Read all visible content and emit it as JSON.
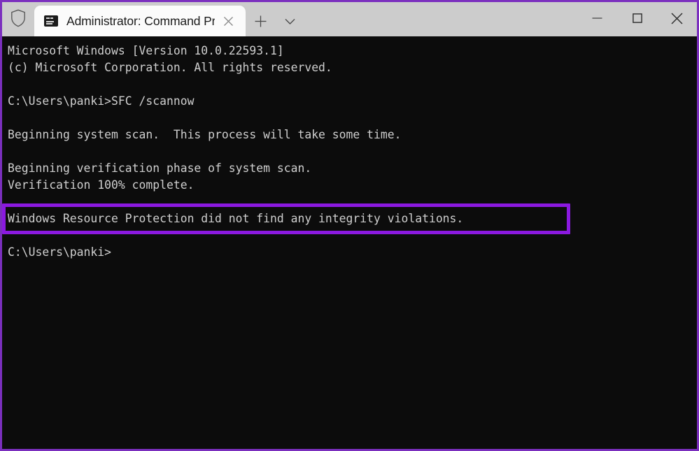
{
  "window": {
    "border_color": "#7b2fbe",
    "titlebar_bg": "#cccccc",
    "terminal_bg": "#0c0c0c",
    "terminal_fg": "#cfcfcf",
    "highlight_color": "#8b19e0"
  },
  "titlebar": {
    "shield_icon": "shield-icon",
    "tab": {
      "icon": "console-icon",
      "title": "Administrator: Command Promp",
      "close_label": "✕"
    },
    "new_tab_label": "+",
    "dropdown_label": "⌄",
    "controls": {
      "minimize": "—",
      "maximize": "☐",
      "close": "✕"
    }
  },
  "terminal": {
    "lines": [
      {
        "id": "version",
        "text": "Microsoft Windows [Version 10.0.22593.1]",
        "blank": false,
        "highlight": false
      },
      {
        "id": "copyright",
        "text": "(c) Microsoft Corporation. All rights reserved.",
        "blank": false,
        "highlight": false
      },
      {
        "id": "blank-1",
        "text": " ",
        "blank": true,
        "highlight": false
      },
      {
        "id": "command-prompt",
        "text": "C:\\Users\\panki>SFC /scannow",
        "blank": false,
        "highlight": false
      },
      {
        "id": "blank-2",
        "text": " ",
        "blank": true,
        "highlight": false
      },
      {
        "id": "scan-begin",
        "text": "Beginning system scan.  This process will take some time.",
        "blank": false,
        "highlight": false
      },
      {
        "id": "blank-3",
        "text": " ",
        "blank": true,
        "highlight": false
      },
      {
        "id": "verify-begin",
        "text": "Beginning verification phase of system scan.",
        "blank": false,
        "highlight": false
      },
      {
        "id": "verify-complete",
        "text": "Verification 100% complete.",
        "blank": false,
        "highlight": false
      },
      {
        "id": "blank-4",
        "text": " ",
        "blank": true,
        "highlight": false
      },
      {
        "id": "result",
        "text": "Windows Resource Protection did not find any integrity violations.",
        "blank": false,
        "highlight": true
      },
      {
        "id": "blank-5",
        "text": " ",
        "blank": true,
        "highlight": false
      },
      {
        "id": "final-prompt",
        "text": "C:\\Users\\panki>",
        "blank": false,
        "highlight": false
      }
    ]
  }
}
